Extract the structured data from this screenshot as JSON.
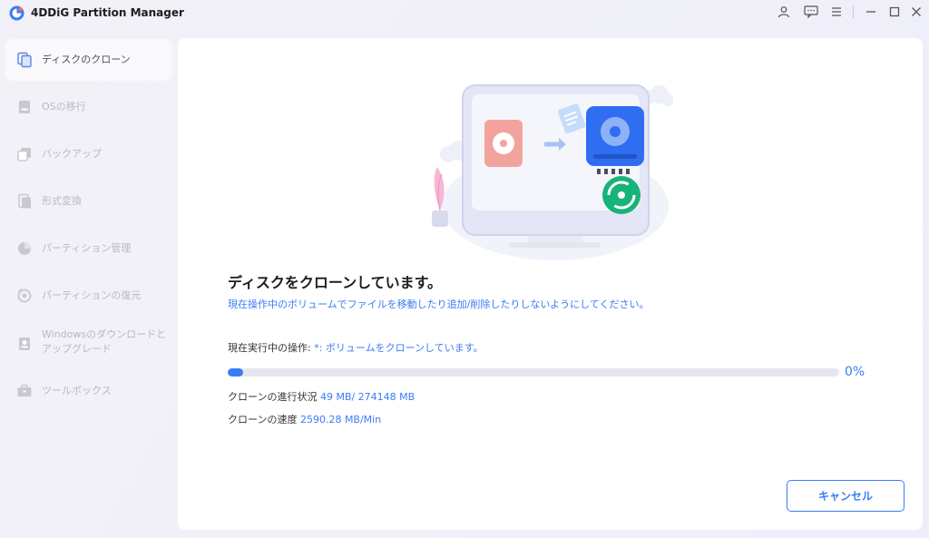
{
  "app": {
    "title": "4DDiG Partition Manager"
  },
  "titlebar": {
    "icons": [
      "user-icon",
      "feedback-icon",
      "menu-icon",
      "minimize-icon",
      "maximize-icon",
      "close-icon"
    ]
  },
  "sidebar": {
    "items": [
      {
        "label": "ディスクのクローン",
        "icon": "disk-clone-icon",
        "active": true
      },
      {
        "label": "OSの移行",
        "icon": "os-migrate-icon",
        "active": false
      },
      {
        "label": "バックアップ",
        "icon": "backup-icon",
        "active": false
      },
      {
        "label": "形式変換",
        "icon": "convert-icon",
        "active": false
      },
      {
        "label": "パーティション管理",
        "icon": "partition-pie-icon",
        "active": false
      },
      {
        "label": "パーティションの復元",
        "icon": "partition-restore-icon",
        "active": false
      },
      {
        "label_line1": "Windowsのダウンロードと",
        "label_line2": "アップグレード",
        "icon": "windows-download-icon",
        "active": false
      },
      {
        "label": "ツールボックス",
        "icon": "toolbox-icon",
        "active": false
      }
    ]
  },
  "main": {
    "heading": "ディスクをクローンしています。",
    "warning": "現在操作中のボリュームでファイルを移動したり追加/削除したりしないようにしてください。",
    "current_op_label": "現在実行中の操作: ",
    "current_op_value": "*: ボリュームをクローンしています。",
    "progress_percent": 0,
    "progress_fill_fraction": 0.025,
    "progress_text": "0%",
    "progress_label": "クローンの進行状況 ",
    "progress_value": "49 MB/ 274148 MB",
    "speed_label": "クローンの速度 ",
    "speed_value": "2590.28 MB/Min",
    "cancel_label": "キャンセル"
  },
  "colors": {
    "accent": "#3a7cf5",
    "source_disk": "#f08a84",
    "target_disk": "#2f6ef0",
    "sync_badge": "#18b37a"
  }
}
